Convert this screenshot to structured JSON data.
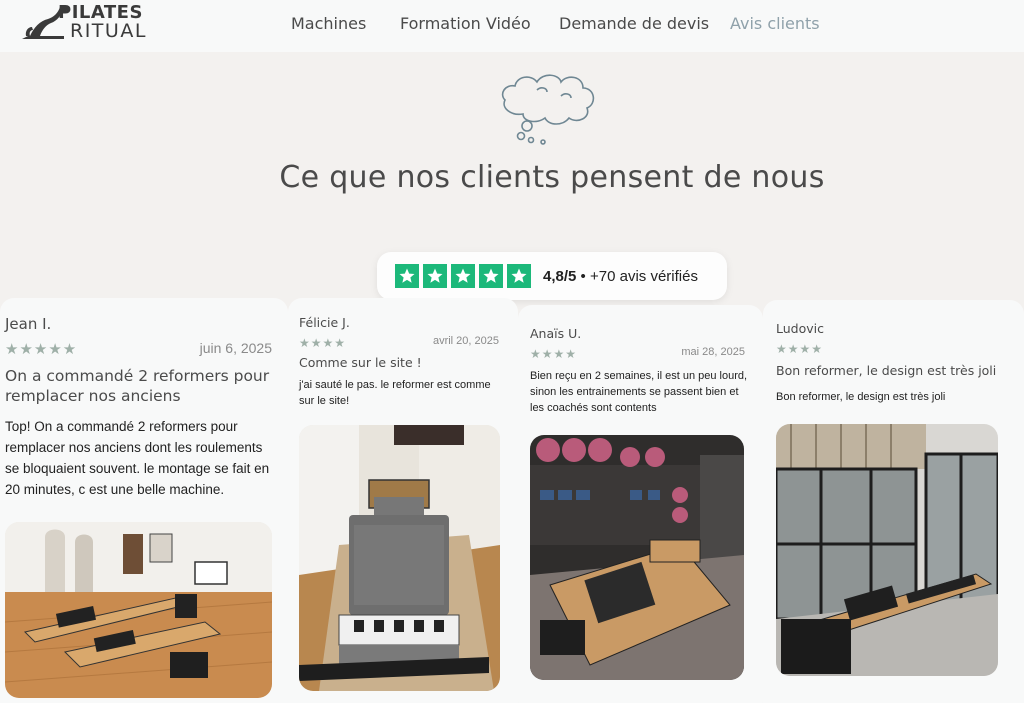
{
  "brand": {
    "line1": "PILATES",
    "line2": "RITUAL"
  },
  "nav": [
    {
      "label": "Machines"
    },
    {
      "label": "Formation Vidéo"
    },
    {
      "label": "Demande de devis"
    },
    {
      "label": "Avis clients"
    }
  ],
  "hero": {
    "title": "Ce que nos clients pensent de nous"
  },
  "rating": {
    "stars": 5,
    "score": "4,8/5",
    "separator": "•",
    "count": "+70 avis vérifiés"
  },
  "reviews": [
    {
      "author": "Jean I.",
      "stars": "★★★★★",
      "date": "juin 6, 2025",
      "title": "On a commandé 2 reformers pour remplacer nos anciens",
      "body": "Top! On a commandé 2 reformers pour remplacer nos anciens dont les roulements se bloquaient souvent. le montage se fait en 20 minutes, c est une belle machine.",
      "photo": "reformer-studio-photo-icon"
    },
    {
      "author": "Félicie J.",
      "stars": "★★★★",
      "date": "avril 20, 2025",
      "title": "Comme sur le site !",
      "body": "j'ai sauté le pas. le reformer est comme sur le site!",
      "photo": "reformer-unboxed-photo-icon"
    },
    {
      "author": "Anaïs U.",
      "stars": "★★★★",
      "date": "mai 28, 2025",
      "title": "",
      "body": "Bien reçu en 2 semaines, il est un peu lourd, sinon les entrainements se passent bien et les coachés sont contents",
      "photo": "reformer-gym-photo-icon"
    },
    {
      "author": "Ludovic",
      "stars": "★★★★",
      "date": "",
      "title": "Bon reformer, le design est très joli",
      "body": "Bon reformer, le design est très joli",
      "photo": "reformer-window-photo-icon"
    }
  ],
  "colors": {
    "background": "#f3f1ef",
    "card": "#f8f9f9",
    "trustpilot_green": "#1cb87a",
    "nav_active": "#8fa1aa",
    "star_muted": "#9fb0a8"
  }
}
